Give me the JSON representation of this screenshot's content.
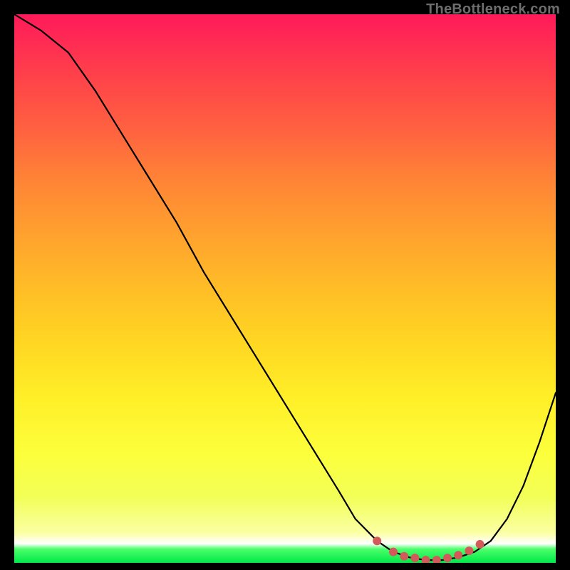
{
  "watermark": "TheBottleneck.com",
  "chart_data": {
    "type": "line",
    "title": "",
    "xlabel": "",
    "ylabel": "",
    "xlim": [
      0,
      100
    ],
    "ylim": [
      0,
      100
    ],
    "grid": false,
    "series": [
      {
        "name": "bottleneck-curve",
        "color": "#000000",
        "x": [
          0,
          5,
          10,
          15,
          20,
          25,
          30,
          35,
          40,
          45,
          50,
          55,
          60,
          63,
          67,
          70,
          73,
          76,
          79,
          82,
          85,
          88,
          91,
          94,
          97,
          100
        ],
        "y": [
          100,
          97,
          93,
          86,
          78,
          70,
          62,
          53,
          45,
          37,
          29,
          21,
          13,
          8,
          4,
          2,
          1,
          0.5,
          0.5,
          1,
          2,
          4,
          8,
          14,
          22,
          31
        ]
      }
    ],
    "markers": {
      "name": "highlight-dots",
      "color": "#d35a5a",
      "points": [
        {
          "x": 67,
          "y": 4
        },
        {
          "x": 70,
          "y": 2
        },
        {
          "x": 72,
          "y": 1.2
        },
        {
          "x": 74,
          "y": 0.9
        },
        {
          "x": 76,
          "y": 0.5
        },
        {
          "x": 78,
          "y": 0.5
        },
        {
          "x": 80,
          "y": 0.9
        },
        {
          "x": 82,
          "y": 1.4
        },
        {
          "x": 84,
          "y": 2.2
        },
        {
          "x": 86,
          "y": 3.4
        }
      ]
    },
    "background_gradient": {
      "stops": [
        {
          "pos": 0.0,
          "color": "#ff1a5a"
        },
        {
          "pos": 0.3,
          "color": "#ff8336"
        },
        {
          "pos": 0.6,
          "color": "#ffd722"
        },
        {
          "pos": 0.88,
          "color": "#f2ff57"
        },
        {
          "pos": 0.965,
          "color": "#ffffff"
        },
        {
          "pos": 1.0,
          "color": "#00e84a"
        }
      ]
    }
  }
}
